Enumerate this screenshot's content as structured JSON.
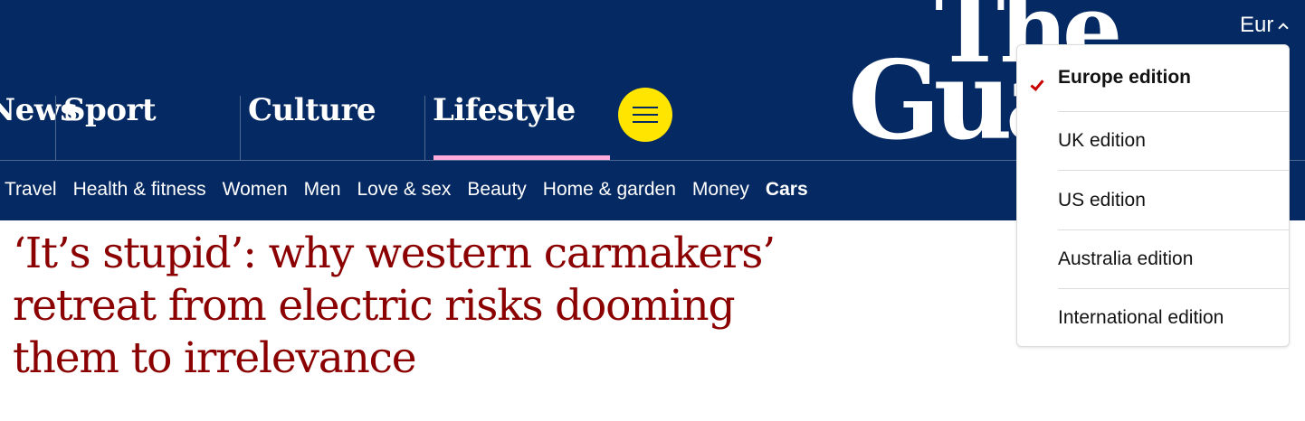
{
  "logo": {
    "line1": "The",
    "line2": "Guardian"
  },
  "edition_toggle": {
    "label": "Eur"
  },
  "pillars": [
    {
      "label": "News"
    },
    {
      "label": "Sport"
    },
    {
      "label": "Culture"
    },
    {
      "label": "Lifestyle",
      "active": true
    }
  ],
  "subnav": [
    {
      "label": "Travel"
    },
    {
      "label": "Health & fitness"
    },
    {
      "label": "Women"
    },
    {
      "label": "Men"
    },
    {
      "label": "Love & sex"
    },
    {
      "label": "Beauty"
    },
    {
      "label": "Home & garden"
    },
    {
      "label": "Money"
    },
    {
      "label": "Cars",
      "active": true
    }
  ],
  "headline": "‘It’s stupid’: why western carmakers’ retreat from electric risks dooming them to irrelevance",
  "edition_dropdown": {
    "items": [
      {
        "label": "Europe edition",
        "selected": true
      },
      {
        "label": "UK edition"
      },
      {
        "label": "US edition"
      },
      {
        "label": "Australia edition"
      },
      {
        "label": "International edition"
      }
    ]
  },
  "colors": {
    "brand_navy": "#052962",
    "menu_button_yellow": "#ffe500",
    "lifestyle_accent_pink": "#ffabdb",
    "headline_red": "#8b0000",
    "check_red": "#c70000"
  }
}
